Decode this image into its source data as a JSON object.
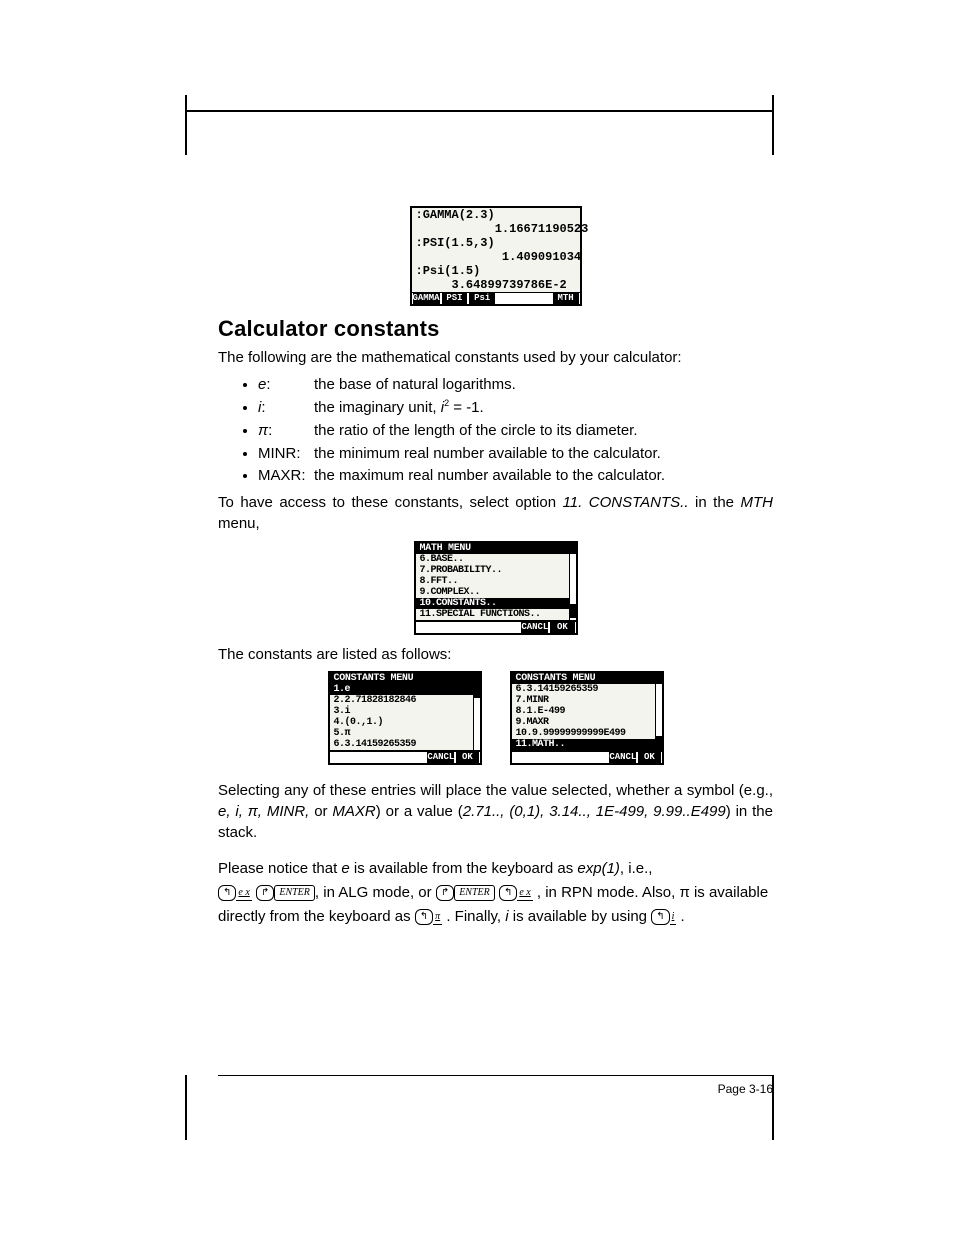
{
  "screenshot1": {
    "lines": [
      ":GAMMA(2.3)",
      "           1.16671190523",
      ":PSI(1.5,3)",
      "            1.409091034",
      ":Psi(1.5)",
      "     3.64899739786E-2"
    ],
    "softkeys": [
      "GAMMA",
      "PSI",
      "Psi",
      "",
      "",
      "MTH"
    ]
  },
  "heading": "Calculator constants",
  "intro": "The following are the mathematical constants used by your calculator:",
  "constants": [
    {
      "sym": "e",
      "desc": "the base of natural logarithms."
    },
    {
      "sym": "i",
      "desc": "the imaginary unit, "
    },
    {
      "sym": "π",
      "desc": "the ratio of the length of the circle to its diameter."
    },
    {
      "sym": "MINR",
      "desc": "the minimum real number available to the calculator."
    },
    {
      "sym": "MAXR",
      "desc": "the maximum real number available to the calculator."
    }
  ],
  "i_formula_pre": "i",
  "i_formula_exp": "2",
  "i_formula_post": " = -1.",
  "access_pre": "To have access to these constants, select option ",
  "access_opt": "11. CONSTANTS..",
  "access_mid": " in the ",
  "access_menu": "MTH",
  "access_post": " menu,",
  "screenshot2": {
    "title": "MATH MENU",
    "items": [
      "6.BASE..",
      "7.PROBABILITY..",
      "8.FFT..",
      "9.COMPLEX..",
      "10.CONSTANTS..",
      "11.SPECIAL FUNCTIONS.."
    ],
    "selected": 4,
    "softkeys": [
      "",
      "",
      "",
      "",
      "CANCL",
      "OK"
    ]
  },
  "listed_intro": "The constants are listed as follows:",
  "screenshot3a": {
    "title": "CONSTANTS MENU",
    "items": [
      "1.e",
      "2.2.71828182846",
      "3.i",
      "4.(0.,1.)",
      "5.π",
      "6.3.14159265359"
    ],
    "selected": 0,
    "softkeys": [
      "",
      "",
      "",
      "",
      "CANCL",
      "OK"
    ]
  },
  "screenshot3b": {
    "title": "CONSTANTS MENU",
    "items": [
      "6.3.14159265359",
      "7.MINR",
      "8.1.E-499",
      "9.MAXR",
      "10.9.99999999999E499",
      "11.MATH.."
    ],
    "selected": 5,
    "softkeys": [
      "",
      "",
      "",
      "",
      "CANCL",
      "OK"
    ]
  },
  "para2_a": "Selecting any of these entries will place the value selected, whether a symbol (e.g., ",
  "para2_syms": "e, i, π, MINR,",
  "para2_or": " or ",
  "para2_maxr": "MAXR",
  "para2_b": ") or a value (",
  "para2_vals": "2.71.., (0,1), 3.14.., 1E-499, 9.99..E499",
  "para2_c": ") in the stack.",
  "para3_a": "Please notice that ",
  "para3_e": "e",
  "para3_b": " is available from the keyboard as ",
  "para3_exp": "exp(1)",
  "para3_c": ", i.e., ",
  "keys": {
    "left": "↰",
    "ex": "e x",
    "right": "↱",
    "enter": "ENTER",
    "pi": "π",
    "i": "i"
  },
  "para3_alg": ", in ALG mode, or ",
  "para3_rpn": ", in RPN mode.  Also, π is available directly from the keyboard as ",
  "para3_fin": ".  Finally, ",
  "para3_i": "i",
  "para3_end": " is available by using ",
  "para3_dot": ".",
  "page_no": "Page 3-16"
}
